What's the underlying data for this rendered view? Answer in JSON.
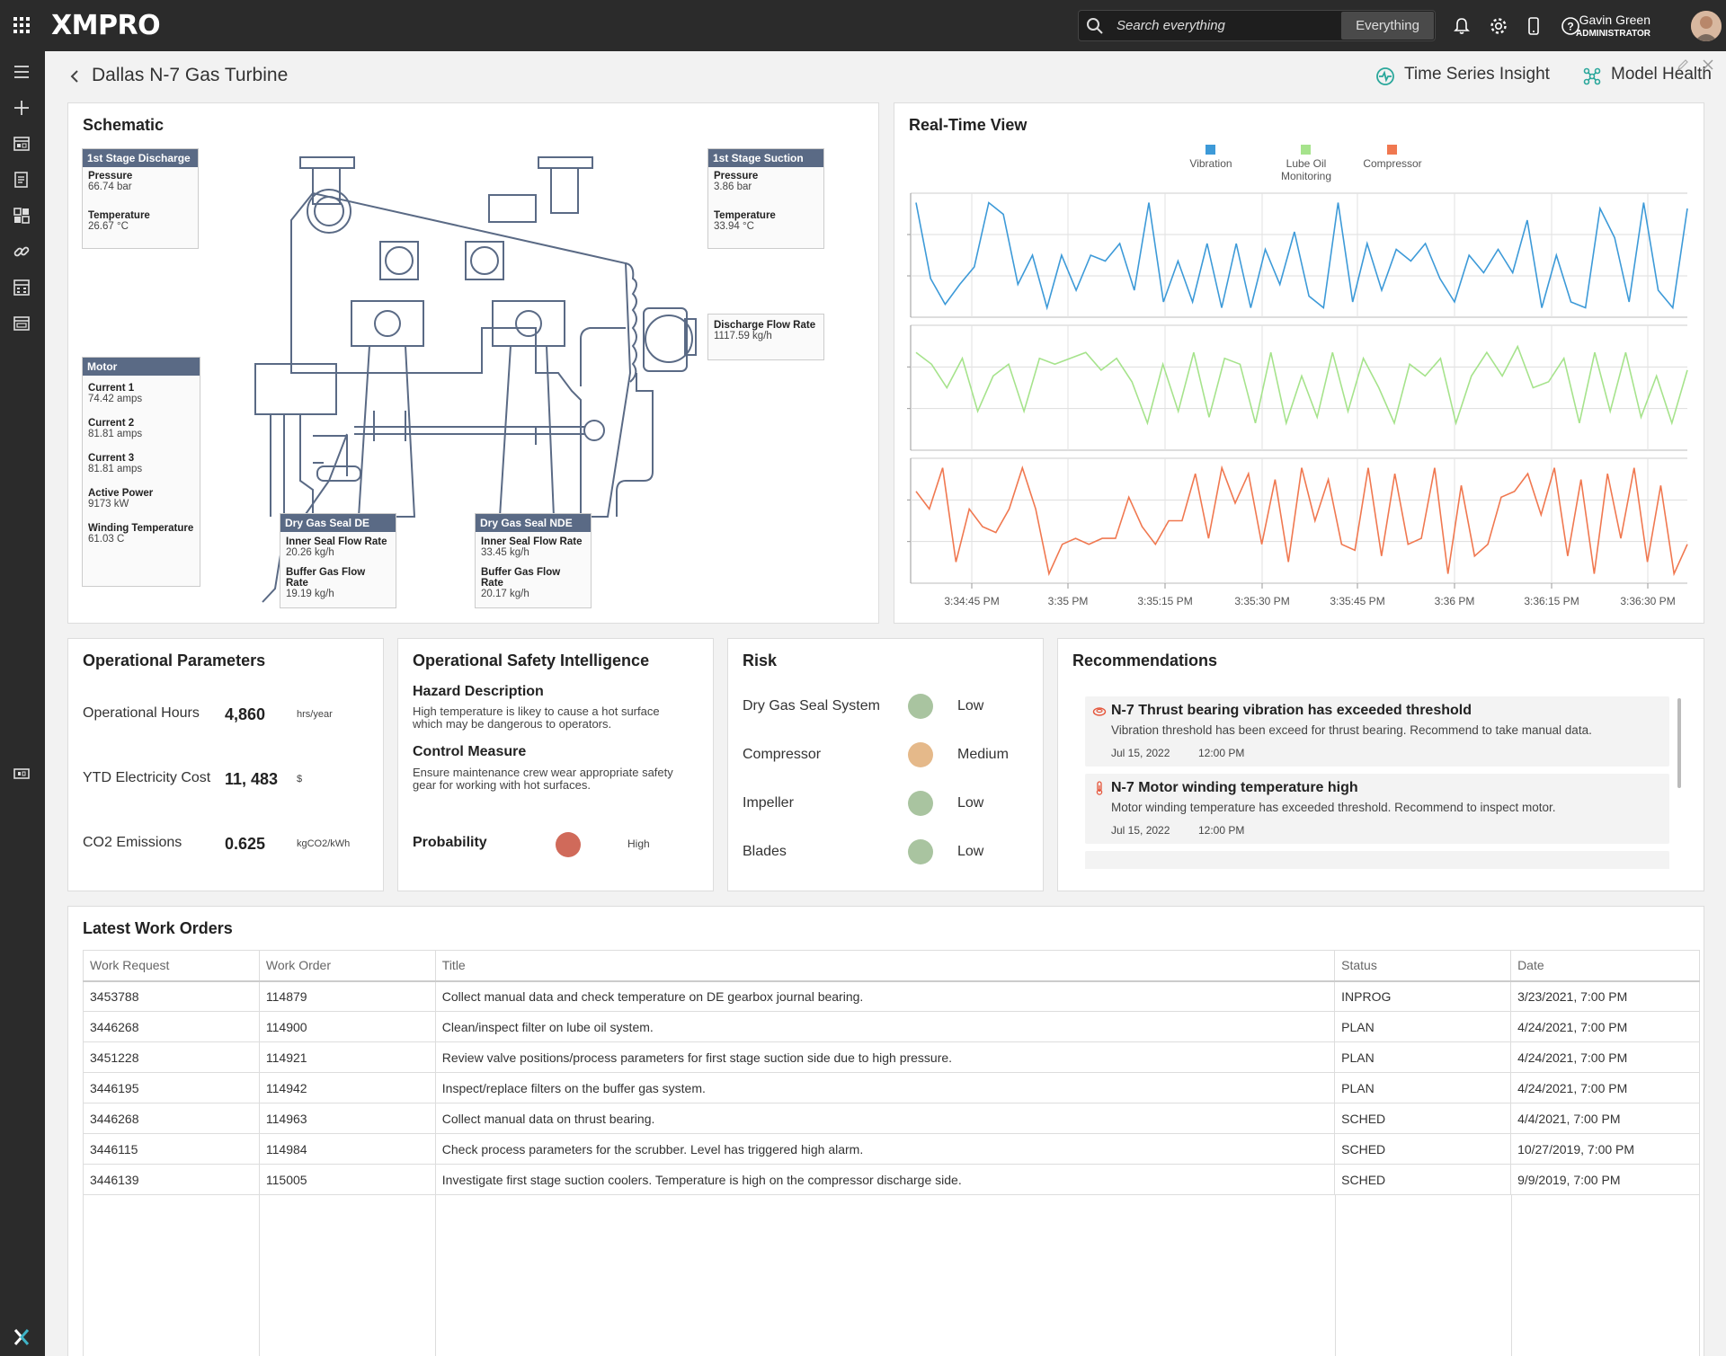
{
  "app": {
    "logo": "XMPRO",
    "search_placeholder": "Search everything",
    "search_scope": "Everything",
    "user": {
      "name": "Gavin Green",
      "role": "ADMINISTRATOR"
    }
  },
  "header": {
    "title": "Dallas N-7 Gas Turbine",
    "links": [
      {
        "label": "Time Series Insight",
        "icon": "pulse-icon"
      },
      {
        "label": "Model Health",
        "icon": "network-icon"
      }
    ]
  },
  "schematic": {
    "title": "Schematic",
    "tags": {
      "stage1_discharge": {
        "title": "1st Stage Discharge",
        "rows": [
          {
            "label": "Pressure",
            "value": "66.74 bar"
          },
          {
            "label": "Temperature",
            "value": "26.67 °C"
          }
        ]
      },
      "stage1_suction": {
        "title": "1st Stage Suction",
        "rows": [
          {
            "label": "Pressure",
            "value": "3.86 bar"
          },
          {
            "label": "Temperature",
            "value": "33.94 °C"
          }
        ]
      },
      "discharge_flow": {
        "label": "Discharge Flow Rate",
        "value": "1117.59 kg/h"
      },
      "motor": {
        "title": "Motor",
        "rows": [
          {
            "label": "Current 1",
            "value": "74.42 amps"
          },
          {
            "label": "Current 2",
            "value": "81.81 amps"
          },
          {
            "label": "Current 3",
            "value": "81.81 amps"
          },
          {
            "label": "Active Power",
            "value": "9173 kW"
          },
          {
            "label": "Winding Temperature",
            "value": "61.03 C"
          }
        ]
      },
      "dgs_de": {
        "title": "Dry Gas Seal DE",
        "rows": [
          {
            "label": "Inner Seal Flow Rate",
            "value": "20.26 kg/h"
          },
          {
            "label": "Buffer Gas Flow Rate",
            "value": "19.19 kg/h"
          }
        ]
      },
      "dgs_nde": {
        "title": "Dry Gas Seal NDE",
        "rows": [
          {
            "label": "Inner Seal Flow Rate",
            "value": "33.45 kg/h"
          },
          {
            "label": "Buffer Gas Flow Rate",
            "value": "20.17 kg/h"
          }
        ]
      }
    }
  },
  "realtime": {
    "title": "Real-Time View"
  },
  "chart_data": {
    "type": "line",
    "title": "Real-Time View",
    "legend_position": "top-center",
    "grid": true,
    "x_ticks": [
      "3:34:45 PM",
      "3:35 PM",
      "3:35:15 PM",
      "3:35:30 PM",
      "3:35:45 PM",
      "3:36 PM",
      "3:36:15 PM",
      "3:36:30 PM"
    ],
    "series": [
      {
        "name": "Compressor",
        "color": "#f07850",
        "values": [
          0.75,
          0.6,
          0.95,
          0.15,
          0.6,
          0.45,
          0.4,
          0.6,
          0.95,
          0.6,
          0.05,
          0.3,
          0.35,
          0.3,
          0.35,
          0.35,
          0.7,
          0.45,
          0.3,
          0.5,
          0.5,
          0.9,
          0.35,
          0.95,
          0.65,
          0.9,
          0.3,
          0.85,
          0.15,
          0.95,
          0.5,
          0.85,
          0.3,
          0.25,
          0.95,
          0.2,
          0.9,
          0.3,
          0.35,
          0.95,
          0.05,
          0.8,
          0.2,
          0.3,
          0.7,
          0.75,
          0.9,
          0.55,
          0.95,
          0.2,
          0.85,
          0.05,
          0.9,
          0.35,
          0.95,
          0.15,
          0.8,
          0.05,
          0.3
        ]
      },
      {
        "name": "Lube Oil Monitoring",
        "color": "#a6e38c",
        "values": [
          0.8,
          0.7,
          0.5,
          0.75,
          0.3,
          0.6,
          0.7,
          0.3,
          0.75,
          0.7,
          0.75,
          0.8,
          0.65,
          0.75,
          0.55,
          0.2,
          0.7,
          0.3,
          0.8,
          0.25,
          0.75,
          0.7,
          0.2,
          0.8,
          0.2,
          0.6,
          0.25,
          0.8,
          0.3,
          0.75,
          0.5,
          0.2,
          0.7,
          0.6,
          0.75,
          0.2,
          0.6,
          0.8,
          0.6,
          0.85,
          0.5,
          0.55,
          0.75,
          0.2,
          0.8,
          0.3,
          0.8,
          0.25,
          0.6,
          0.2,
          0.65
        ]
      },
      {
        "name": "Vibration",
        "color": "#3d9ad8",
        "values": [
          0.95,
          0.3,
          0.08,
          0.25,
          0.4,
          0.95,
          0.85,
          0.25,
          0.5,
          0.05,
          0.5,
          0.2,
          0.5,
          0.45,
          0.6,
          0.2,
          0.95,
          0.1,
          0.45,
          0.1,
          0.6,
          0.05,
          0.6,
          0.05,
          0.55,
          0.25,
          0.7,
          0.15,
          0.05,
          0.95,
          0.1,
          0.6,
          0.2,
          0.55,
          0.45,
          0.6,
          0.3,
          0.1,
          0.5,
          0.35,
          0.55,
          0.35,
          0.8,
          0.05,
          0.5,
          0.1,
          0.05,
          0.9,
          0.65,
          0.1,
          0.95,
          0.2,
          0.05,
          0.9
        ]
      }
    ]
  },
  "op_params": {
    "title": "Operational Parameters",
    "rows": [
      {
        "label": "Operational Hours",
        "value": "4,860",
        "unit": "hrs/year"
      },
      {
        "label": "YTD Electricity Cost",
        "value": "11, 483",
        "unit": "$"
      },
      {
        "label": "CO2 Emissions",
        "value": "0.625",
        "unit": "kgCO2/kWh"
      }
    ]
  },
  "safety": {
    "title": "Operational Safety Intelligence",
    "hazard_heading": "Hazard Description",
    "hazard_text": "High temperature is likey to cause a hot surface which may be dangerous to operators.",
    "control_heading": "Control Measure",
    "control_text": "Ensure maintenance crew wear appropriate safety gear for working with hot surfaces.",
    "probability_label": "Probability",
    "probability_value": "High",
    "probability_color": "#d06a5a"
  },
  "risk": {
    "title": "Risk",
    "items": [
      {
        "label": "Dry Gas Seal System",
        "level": "Low",
        "color": "#a9c4a0"
      },
      {
        "label": "Compressor",
        "level": "Medium",
        "color": "#e5b98a"
      },
      {
        "label": "Impeller",
        "level": "Low",
        "color": "#a9c4a0"
      },
      {
        "label": "Blades",
        "level": "Low",
        "color": "#a9c4a0"
      }
    ]
  },
  "recommendations": {
    "title": "Recommendations",
    "items": [
      {
        "icon": "bearing-icon",
        "title": "N-7 Thrust bearing vibration has exceeded threshold",
        "description": "Vibration threshold has been exceed for thrust bearing. Recommend to take manual data.",
        "date": "Jul 15, 2022",
        "time": "12:00 PM"
      },
      {
        "icon": "thermometer-icon",
        "title": "N-7 Motor winding temperature high",
        "description": "Motor winding temperature has exceeded threshold. Recommend to inspect motor.",
        "date": "Jul 15, 2022",
        "time": "12:00 PM"
      }
    ]
  },
  "work_orders": {
    "title": "Latest Work Orders",
    "columns": [
      "Work Request",
      "Work Order",
      "Title",
      "Status",
      "Date"
    ],
    "rows": [
      [
        "3453788",
        "114879",
        "Collect manual data and check temperature on DE gearbox journal bearing.",
        "INPROG",
        "3/23/2021, 7:00 PM"
      ],
      [
        "3446268",
        "114900",
        "Clean/inspect filter on lube oil system.",
        "PLAN",
        "4/24/2021, 7:00 PM"
      ],
      [
        "3451228",
        "114921",
        "Review valve positions/process parameters for first stage suction side due to high pressure.",
        "PLAN",
        "4/24/2021, 7:00 PM"
      ],
      [
        "3446195",
        "114942",
        "Inspect/replace filters on the buffer gas system.",
        "PLAN",
        "4/24/2021, 7:00 PM"
      ],
      [
        "3446268",
        "114963",
        "Collect manual data on thrust bearing.",
        "SCHED",
        "4/4/2021, 7:00 PM"
      ],
      [
        "3446115",
        "114984",
        "Check process parameters for the scrubber. Level has triggered high alarm.",
        "SCHED",
        "10/27/2019, 7:00 PM"
      ],
      [
        "3446139",
        "115005",
        "Investigate first stage suction coolers. Temperature is high on the compressor discharge side.",
        "SCHED",
        "9/9/2019, 7:00 PM"
      ]
    ]
  }
}
